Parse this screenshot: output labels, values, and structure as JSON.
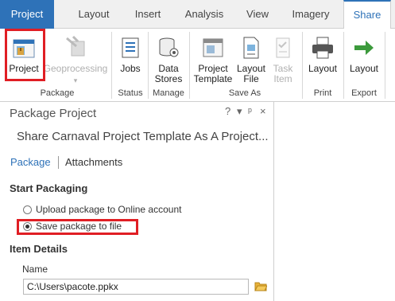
{
  "tabs": [
    "Project",
    "Layout",
    "Insert",
    "Analysis",
    "View",
    "Imagery",
    "Share"
  ],
  "ribbon": {
    "buttons": {
      "project": "Project",
      "geoprocessing": "Geoprocessing",
      "jobs": "Jobs",
      "data_stores_1": "Data",
      "data_stores_2": "Stores",
      "project_template_1": "Project",
      "project_template_2": "Template",
      "layout_file_1": "Layout",
      "layout_file_2": "File",
      "task_item_1": "Task",
      "task_item_2": "Item",
      "print_layout": "Layout",
      "export_layout": "Layout"
    },
    "groups": [
      "Package",
      "Status",
      "Manage",
      "Save As",
      "Print",
      "Export"
    ]
  },
  "pane": {
    "title": "Package Project",
    "controls": [
      "?",
      "▾",
      "ᵖ",
      "×"
    ],
    "subtitle": "Share Carnaval Project Template As A Project...",
    "links": [
      "Package",
      "Attachments"
    ],
    "start_packaging": "Start Packaging",
    "options": [
      "Upload package to Online account",
      "Save package to file"
    ],
    "item_details": "Item Details",
    "name_label": "Name",
    "name_value": "C:\\Users\\pacote.ppkx"
  },
  "colors": {
    "accent": "#2e72b8",
    "highlight": "#e01e24"
  }
}
